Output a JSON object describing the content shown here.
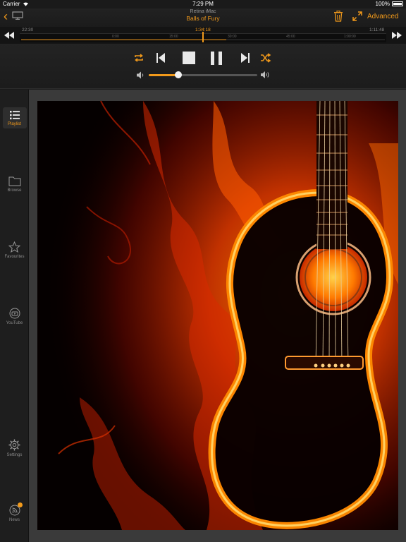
{
  "status_bar": {
    "carrier": "Carrier",
    "time": "7:29 PM",
    "battery": "100%"
  },
  "header": {
    "device": "Retina iMac",
    "song": "Balls of Fury",
    "advanced_label": "Advanced"
  },
  "timeline": {
    "elapsed": "22:30",
    "current": "1:34:18",
    "total": "1:11:48",
    "ticks": [
      "0:00",
      "15:00",
      "30:00",
      "45:00",
      "1:00:00"
    ],
    "progress": 0.56
  },
  "volume": {
    "level": 0.27
  },
  "sidebar": {
    "items": [
      {
        "label": "Playlist"
      },
      {
        "label": "Browse"
      },
      {
        "label": "Favourites"
      },
      {
        "label": "YouTube"
      },
      {
        "label": "Settings"
      },
      {
        "label": "News"
      }
    ]
  },
  "colors": {
    "accent": "#f29a1b",
    "background": "#1a1a1a",
    "sidebar": "#1e1e1e"
  },
  "icons": [
    "back-icon",
    "monitor-icon",
    "trash-icon",
    "expand-icon",
    "rewind-icon",
    "fast-forward-icon",
    "repeat-icon",
    "previous-icon",
    "stop-icon",
    "pause-icon",
    "next-icon",
    "shuffle-icon",
    "volume-low-icon",
    "volume-high-icon",
    "playlist-icon",
    "folder-icon",
    "star-icon",
    "youtube-icon",
    "gear-icon",
    "rss-icon"
  ]
}
